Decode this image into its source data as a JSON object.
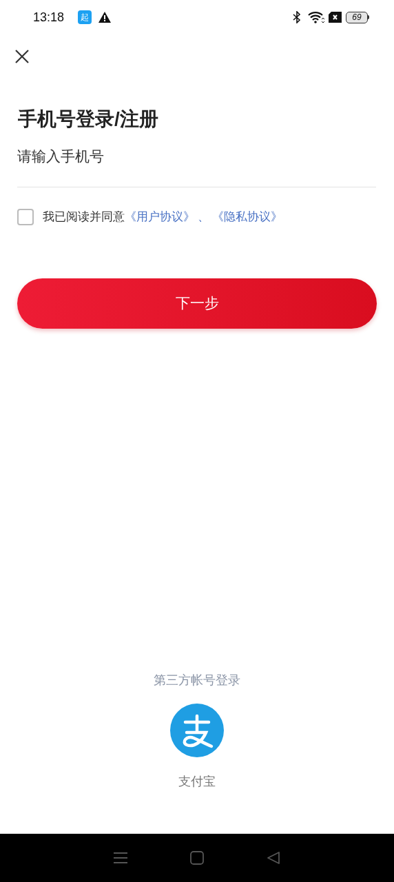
{
  "status_bar": {
    "time": "13:18",
    "app_badge": "起",
    "battery": "69"
  },
  "title": "手机号登录/注册",
  "phone_field": {
    "placeholder": "请输入手机号"
  },
  "agreement": {
    "checked": false,
    "text": "我已阅读并同意",
    "links": [
      "《用户协议》",
      "《隐私协议》"
    ],
    "separator": "、"
  },
  "next_button": "下一步",
  "third_party": {
    "heading": "第三方帐号登录",
    "providers": [
      {
        "label": "支付宝"
      }
    ]
  }
}
